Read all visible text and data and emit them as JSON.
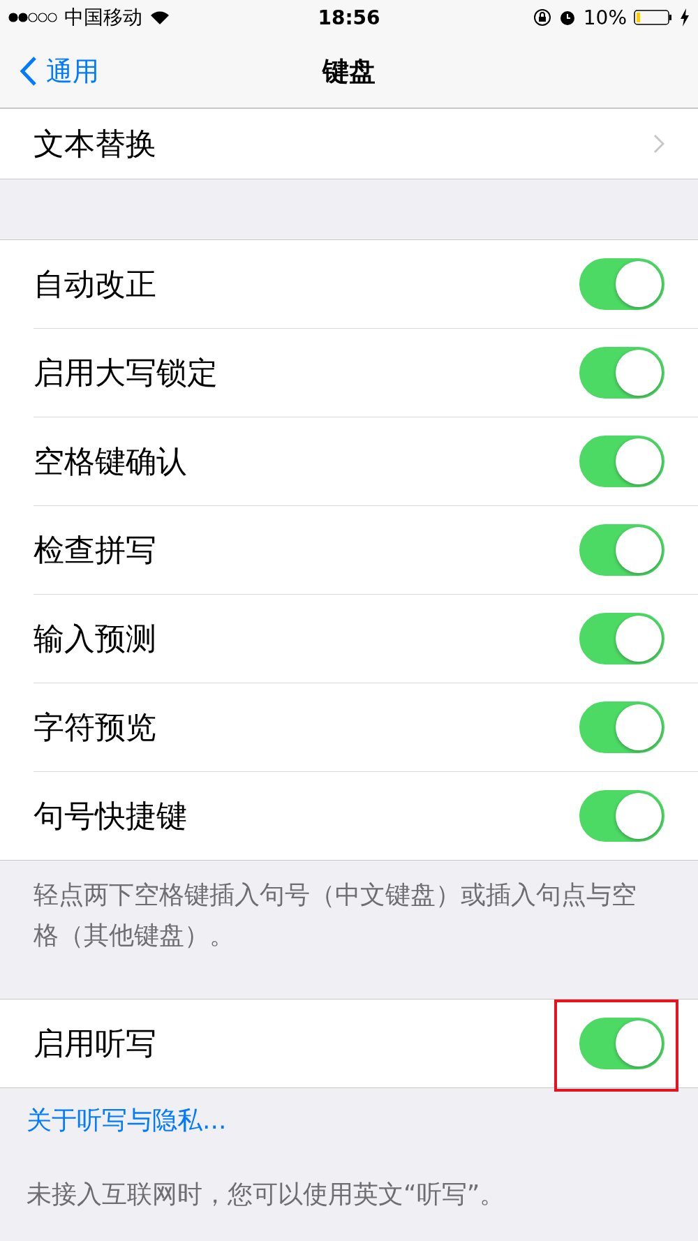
{
  "status_bar": {
    "carrier": "中国移动",
    "time": "18:56",
    "battery": "10%"
  },
  "nav": {
    "back": "通用",
    "title": "键盘"
  },
  "top_row": {
    "label": "文本替换"
  },
  "toggles": [
    {
      "label": "自动改正",
      "on": true
    },
    {
      "label": "启用大写锁定",
      "on": true
    },
    {
      "label": "空格键确认",
      "on": true
    },
    {
      "label": "检查拼写",
      "on": true
    },
    {
      "label": "输入预测",
      "on": true
    },
    {
      "label": "字符预览",
      "on": true
    },
    {
      "label": "句号快捷键",
      "on": true
    }
  ],
  "toggles_footer": "轻点两下空格键插入句号（中文键盘）或插入句点与空格（其他键盘）。",
  "dictation": {
    "label": "启用听写",
    "on": true,
    "highlighted": true
  },
  "privacy_link": "关于听写与隐私...",
  "dictation_footer": "未接入互联网时，您可以使用英文“听写”。"
}
